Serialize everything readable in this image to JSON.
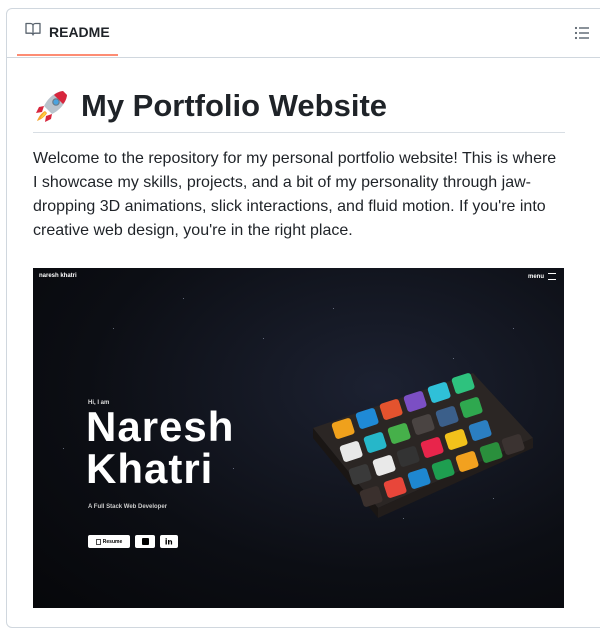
{
  "readme": {
    "tab_label": "README",
    "title": "My Portfolio Website",
    "intro": "Welcome to the repository for my personal portfolio website! This is where I showcase my skills, projects, and a bit of my personality through jaw-dropping 3D animations, slick interactions, and fluid motion. If you're into creative web design, you're in the right place."
  },
  "icons": {
    "tab": "book-icon",
    "outline": "list-icon",
    "title": "rocket-emoji"
  },
  "hero": {
    "brand": "naresh khatri",
    "menu": "menu",
    "greeting": "Hi, I am",
    "name_line1": "Naresh",
    "name_line2": "Khatri",
    "role": "A Full Stack Web Developer",
    "resume_label": "Resume"
  },
  "colors": {
    "tab_underline": "#fd8c73",
    "border": "#d0d7de",
    "text": "#1f2328",
    "hero_bg": "#0c0e14"
  }
}
